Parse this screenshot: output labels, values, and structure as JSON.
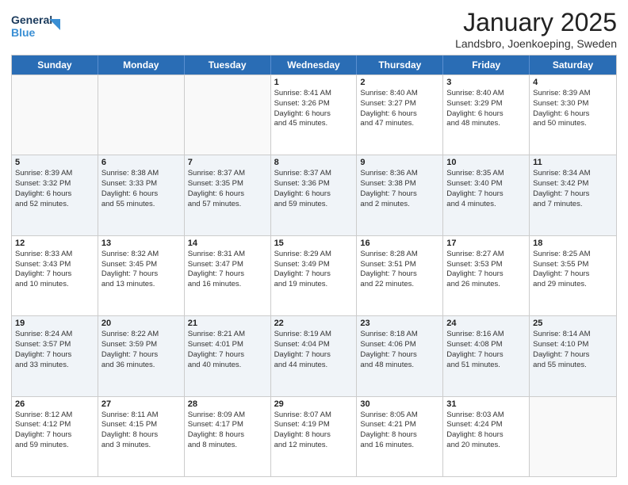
{
  "header": {
    "logo_line1": "General",
    "logo_line2": "Blue",
    "month_title": "January 2025",
    "location": "Landsbro, Joenkoeping, Sweden"
  },
  "days_of_week": [
    "Sunday",
    "Monday",
    "Tuesday",
    "Wednesday",
    "Thursday",
    "Friday",
    "Saturday"
  ],
  "weeks": [
    [
      {
        "day": "",
        "content": ""
      },
      {
        "day": "",
        "content": ""
      },
      {
        "day": "",
        "content": ""
      },
      {
        "day": "1",
        "content": "Sunrise: 8:41 AM\nSunset: 3:26 PM\nDaylight: 6 hours\nand 45 minutes."
      },
      {
        "day": "2",
        "content": "Sunrise: 8:40 AM\nSunset: 3:27 PM\nDaylight: 6 hours\nand 47 minutes."
      },
      {
        "day": "3",
        "content": "Sunrise: 8:40 AM\nSunset: 3:29 PM\nDaylight: 6 hours\nand 48 minutes."
      },
      {
        "day": "4",
        "content": "Sunrise: 8:39 AM\nSunset: 3:30 PM\nDaylight: 6 hours\nand 50 minutes."
      }
    ],
    [
      {
        "day": "5",
        "content": "Sunrise: 8:39 AM\nSunset: 3:32 PM\nDaylight: 6 hours\nand 52 minutes."
      },
      {
        "day": "6",
        "content": "Sunrise: 8:38 AM\nSunset: 3:33 PM\nDaylight: 6 hours\nand 55 minutes."
      },
      {
        "day": "7",
        "content": "Sunrise: 8:37 AM\nSunset: 3:35 PM\nDaylight: 6 hours\nand 57 minutes."
      },
      {
        "day": "8",
        "content": "Sunrise: 8:37 AM\nSunset: 3:36 PM\nDaylight: 6 hours\nand 59 minutes."
      },
      {
        "day": "9",
        "content": "Sunrise: 8:36 AM\nSunset: 3:38 PM\nDaylight: 7 hours\nand 2 minutes."
      },
      {
        "day": "10",
        "content": "Sunrise: 8:35 AM\nSunset: 3:40 PM\nDaylight: 7 hours\nand 4 minutes."
      },
      {
        "day": "11",
        "content": "Sunrise: 8:34 AM\nSunset: 3:42 PM\nDaylight: 7 hours\nand 7 minutes."
      }
    ],
    [
      {
        "day": "12",
        "content": "Sunrise: 8:33 AM\nSunset: 3:43 PM\nDaylight: 7 hours\nand 10 minutes."
      },
      {
        "day": "13",
        "content": "Sunrise: 8:32 AM\nSunset: 3:45 PM\nDaylight: 7 hours\nand 13 minutes."
      },
      {
        "day": "14",
        "content": "Sunrise: 8:31 AM\nSunset: 3:47 PM\nDaylight: 7 hours\nand 16 minutes."
      },
      {
        "day": "15",
        "content": "Sunrise: 8:29 AM\nSunset: 3:49 PM\nDaylight: 7 hours\nand 19 minutes."
      },
      {
        "day": "16",
        "content": "Sunrise: 8:28 AM\nSunset: 3:51 PM\nDaylight: 7 hours\nand 22 minutes."
      },
      {
        "day": "17",
        "content": "Sunrise: 8:27 AM\nSunset: 3:53 PM\nDaylight: 7 hours\nand 26 minutes."
      },
      {
        "day": "18",
        "content": "Sunrise: 8:25 AM\nSunset: 3:55 PM\nDaylight: 7 hours\nand 29 minutes."
      }
    ],
    [
      {
        "day": "19",
        "content": "Sunrise: 8:24 AM\nSunset: 3:57 PM\nDaylight: 7 hours\nand 33 minutes."
      },
      {
        "day": "20",
        "content": "Sunrise: 8:22 AM\nSunset: 3:59 PM\nDaylight: 7 hours\nand 36 minutes."
      },
      {
        "day": "21",
        "content": "Sunrise: 8:21 AM\nSunset: 4:01 PM\nDaylight: 7 hours\nand 40 minutes."
      },
      {
        "day": "22",
        "content": "Sunrise: 8:19 AM\nSunset: 4:04 PM\nDaylight: 7 hours\nand 44 minutes."
      },
      {
        "day": "23",
        "content": "Sunrise: 8:18 AM\nSunset: 4:06 PM\nDaylight: 7 hours\nand 48 minutes."
      },
      {
        "day": "24",
        "content": "Sunrise: 8:16 AM\nSunset: 4:08 PM\nDaylight: 7 hours\nand 51 minutes."
      },
      {
        "day": "25",
        "content": "Sunrise: 8:14 AM\nSunset: 4:10 PM\nDaylight: 7 hours\nand 55 minutes."
      }
    ],
    [
      {
        "day": "26",
        "content": "Sunrise: 8:12 AM\nSunset: 4:12 PM\nDaylight: 7 hours\nand 59 minutes."
      },
      {
        "day": "27",
        "content": "Sunrise: 8:11 AM\nSunset: 4:15 PM\nDaylight: 8 hours\nand 3 minutes."
      },
      {
        "day": "28",
        "content": "Sunrise: 8:09 AM\nSunset: 4:17 PM\nDaylight: 8 hours\nand 8 minutes."
      },
      {
        "day": "29",
        "content": "Sunrise: 8:07 AM\nSunset: 4:19 PM\nDaylight: 8 hours\nand 12 minutes."
      },
      {
        "day": "30",
        "content": "Sunrise: 8:05 AM\nSunset: 4:21 PM\nDaylight: 8 hours\nand 16 minutes."
      },
      {
        "day": "31",
        "content": "Sunrise: 8:03 AM\nSunset: 4:24 PM\nDaylight: 8 hours\nand 20 minutes."
      },
      {
        "day": "",
        "content": ""
      }
    ]
  ]
}
